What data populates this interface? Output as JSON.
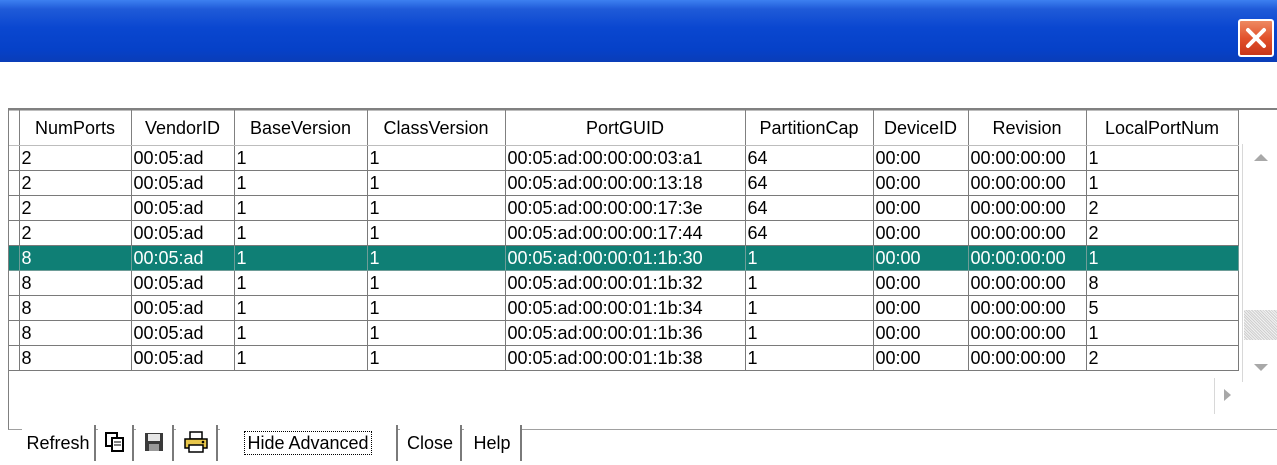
{
  "window": {
    "close_icon": "close-x-icon",
    "accent": "#0a47d0"
  },
  "table": {
    "columns": [
      "NumPorts",
      "VendorID",
      "BaseVersion",
      "ClassVersion",
      "PortGUID",
      "PartitionCap",
      "DeviceID",
      "Revision",
      "LocalPortNum"
    ],
    "rows": [
      [
        "2",
        "00:05:ad",
        "1",
        "1",
        "00:05:ad:00:00:00:03:a1",
        "64",
        "00:00",
        "00:00:00:00",
        "1"
      ],
      [
        "2",
        "00:05:ad",
        "1",
        "1",
        "00:05:ad:00:00:00:13:18",
        "64",
        "00:00",
        "00:00:00:00",
        "1"
      ],
      [
        "2",
        "00:05:ad",
        "1",
        "1",
        "00:05:ad:00:00:00:17:3e",
        "64",
        "00:00",
        "00:00:00:00",
        "2"
      ],
      [
        "2",
        "00:05:ad",
        "1",
        "1",
        "00:05:ad:00:00:00:17:44",
        "64",
        "00:00",
        "00:00:00:00",
        "2"
      ],
      [
        "8",
        "00:05:ad",
        "1",
        "1",
        "00:05:ad:00:00:01:1b:30",
        "1",
        "00:00",
        "00:00:00:00",
        "1"
      ],
      [
        "8",
        "00:05:ad",
        "1",
        "1",
        "00:05:ad:00:00:01:1b:32",
        "1",
        "00:00",
        "00:00:00:00",
        "8"
      ],
      [
        "8",
        "00:05:ad",
        "1",
        "1",
        "00:05:ad:00:00:01:1b:34",
        "1",
        "00:00",
        "00:00:00:00",
        "5"
      ],
      [
        "8",
        "00:05:ad",
        "1",
        "1",
        "00:05:ad:00:00:01:1b:36",
        "1",
        "00:00",
        "00:00:00:00",
        "1"
      ],
      [
        "8",
        "00:05:ad",
        "1",
        "1",
        "00:05:ad:00:00:01:1b:38",
        "1",
        "00:00",
        "00:00:00:00",
        "2"
      ]
    ],
    "selected_row": 4,
    "selected_color": "#0f7f75"
  },
  "toolbar": {
    "refresh_label": "Refresh",
    "copy_icon": "copy-icon",
    "save_icon": "save-icon",
    "print_icon": "print-icon",
    "hide_advanced_label": "Hide Advanced",
    "close_label": "Close",
    "help_label": "Help"
  }
}
